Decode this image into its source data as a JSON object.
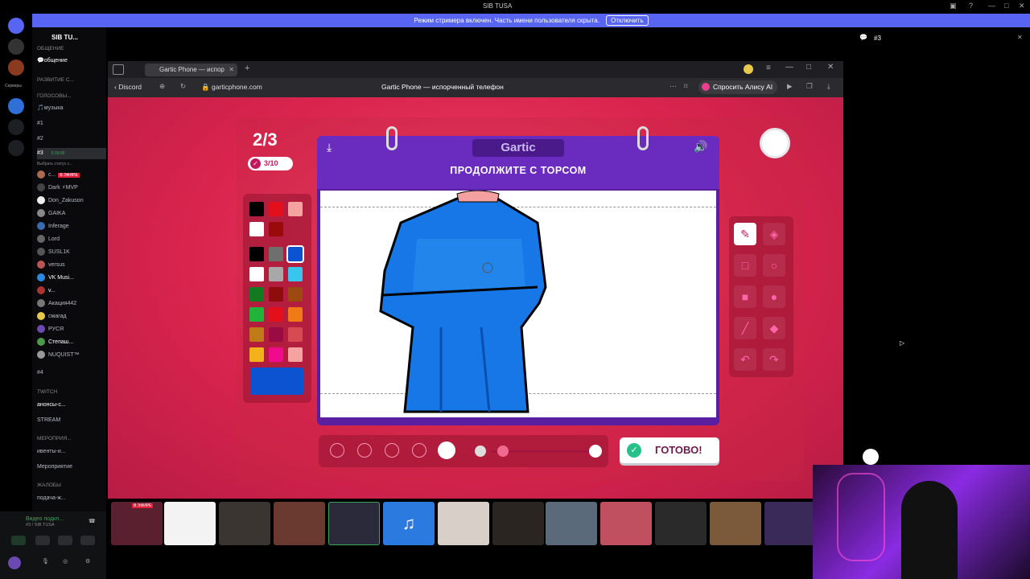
{
  "window": {
    "title": "SIB TUSA"
  },
  "banner": {
    "text": "Режим стримера включен. Часть имени пользователя скрыта.",
    "button": "Отключить"
  },
  "sidebar": {
    "server_name": "SIB TU...",
    "servers_label": "Серверы",
    "items": [
      {
        "label": "ОБЩЕНИЕ",
        "kind": "category"
      },
      {
        "label": "💬общение",
        "kind": "text"
      },
      {
        "label": "РАЗВИТИЕ С...",
        "kind": "category"
      },
      {
        "label": "ГОЛОСОВЫ...",
        "kind": "category"
      },
      {
        "label": "🎵музыка",
        "kind": "text"
      },
      {
        "label": "#1",
        "kind": "voice"
      },
      {
        "label": "#2",
        "kind": "voice"
      },
      {
        "label": "#3",
        "kind": "voice",
        "time": "5:39:06"
      },
      {
        "label": "Выбрать статус с...",
        "kind": "status"
      }
    ],
    "members": [
      {
        "name": "с...",
        "badge": "В ЭФИРЕ"
      },
      {
        "name": "Dark ⚡МVP"
      },
      {
        "name": "Don_Zakuson"
      },
      {
        "name": "GAIKA"
      },
      {
        "name": "Inferage"
      },
      {
        "name": "Lord"
      },
      {
        "name": "SUSL1K"
      },
      {
        "name": "versus"
      },
      {
        "name": "VK Musi..."
      },
      {
        "name": "v..."
      },
      {
        "name": "Акация442"
      },
      {
        "name": "смагад"
      },
      {
        "name": "РУСЯ"
      },
      {
        "name": "Степаш..."
      },
      {
        "name": "NUQUIST™"
      }
    ],
    "items2": [
      {
        "label": "#4",
        "kind": "voice"
      },
      {
        "label": "TWITCH",
        "kind": "category"
      },
      {
        "label": "анонсы-с...",
        "kind": "text"
      },
      {
        "label": "STREAM",
        "kind": "text"
      },
      {
        "label": "МЕРОПРИЯ...",
        "kind": "category"
      },
      {
        "label": "ивенты-и...",
        "kind": "text"
      },
      {
        "label": "Мероприятие",
        "kind": "event"
      },
      {
        "label": "ЖАЛОБЫ",
        "kind": "category"
      },
      {
        "label": "подача-ж...",
        "kind": "text"
      }
    ]
  },
  "voice_status": {
    "title": "Видео подкл...",
    "subtitle": "#3 / SIB TUSA"
  },
  "browser": {
    "tab_title": "Gartic Phone — испор",
    "back_label": "Discord",
    "url": "garticphone.com",
    "page_title": "Gartic Phone — испорченный телефон",
    "alice_button": "Спросить Алису AI"
  },
  "game": {
    "round": "2/3",
    "progress": "3/10",
    "logo": "Gartic",
    "prompt": "ПРОДОЛЖИТЕ С ТОРСОМ",
    "done_button": "ГОТОВО!",
    "colors": {
      "row1": [
        "#000000",
        "#e3101c",
        "#f5a3a0",
        "#ffffff",
        "#9b0a0a"
      ],
      "grid": [
        "#000000",
        "#6f6f6f",
        "#0b53d0",
        "#ffffff",
        "#a8a8a8",
        "#38c6ef",
        "#137a1f",
        "#8e0c0c",
        "#9c4a12",
        "#22b43a",
        "#e3101c",
        "#f07a16",
        "#c17a1a",
        "#9b0b43",
        "#d64a52",
        "#f3b21b",
        "#f00a8c",
        "#f5a3a0"
      ],
      "selected": "#0b53d0"
    }
  },
  "right_panel": {
    "channel": "#3"
  },
  "stream_strip": {
    "live_badge": "В ЭФИРЕ"
  }
}
